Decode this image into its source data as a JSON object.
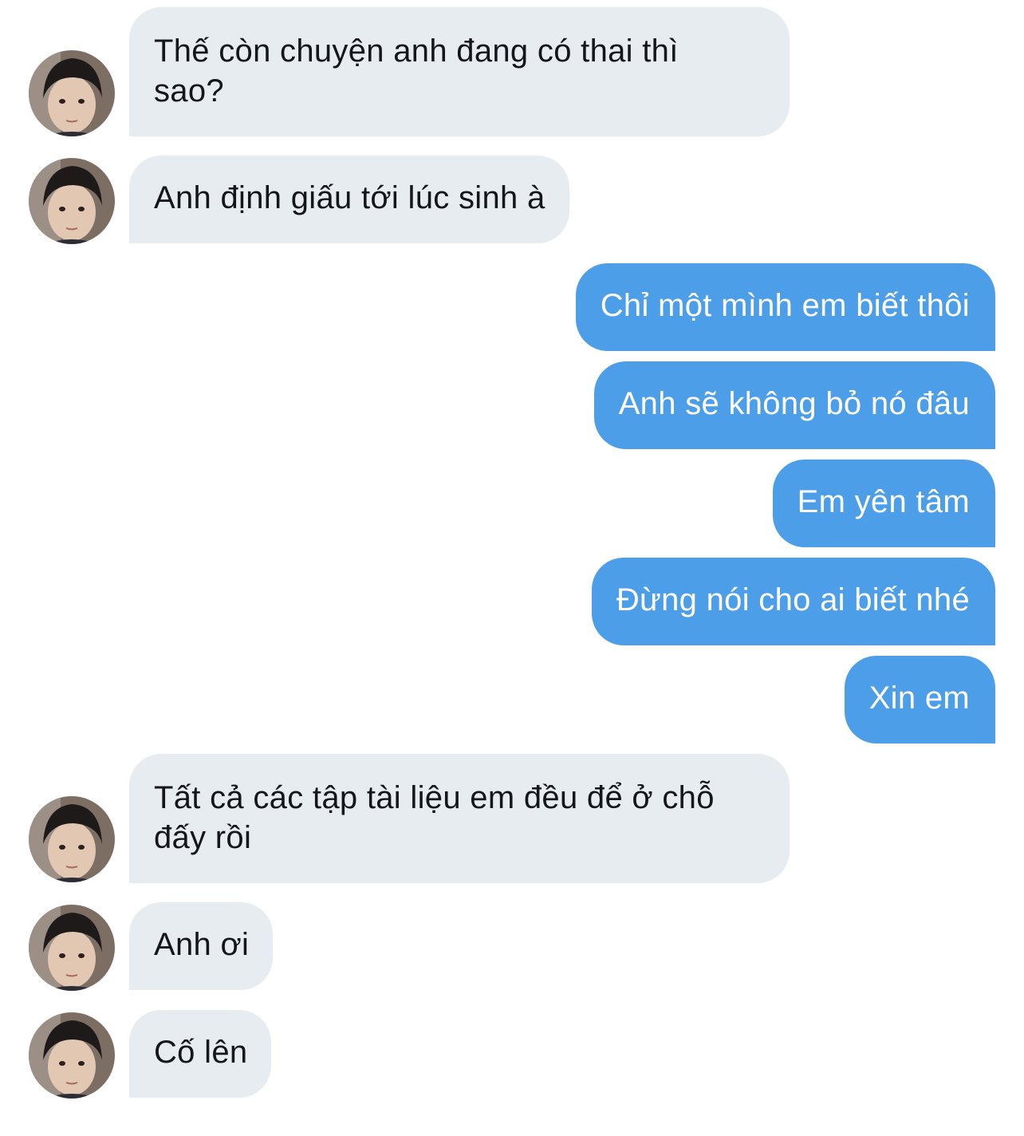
{
  "messages": [
    {
      "from": "them",
      "lines": [
        "Thế còn chuyện anh đang có thai thì",
        "sao?"
      ]
    },
    {
      "from": "them",
      "lines": [
        "Anh định giấu tới lúc sinh à"
      ]
    },
    {
      "from": "me",
      "lines": [
        "Chỉ một mình em biết thôi"
      ]
    },
    {
      "from": "me",
      "lines": [
        "Anh sẽ không bỏ nó đâu"
      ]
    },
    {
      "from": "me",
      "lines": [
        "Em yên tâm"
      ]
    },
    {
      "from": "me",
      "lines": [
        "Đừng nói cho ai biết nhé"
      ]
    },
    {
      "from": "me",
      "lines": [
        "Xin em"
      ]
    },
    {
      "from": "them",
      "lines": [
        "Tất cả các tập tài liệu em đều để ở chỗ",
        "đấy rồi"
      ]
    },
    {
      "from": "them",
      "lines": [
        "Anh ơi"
      ]
    },
    {
      "from": "them",
      "lines": [
        "Cố lên"
      ]
    }
  ],
  "colors": {
    "incoming_bubble": "#e7ecf0",
    "incoming_text": "#14171a",
    "outgoing_bubble": "#4d9ee9",
    "outgoing_text": "#ffffff"
  },
  "avatar_icon": "user-photo-avatar"
}
